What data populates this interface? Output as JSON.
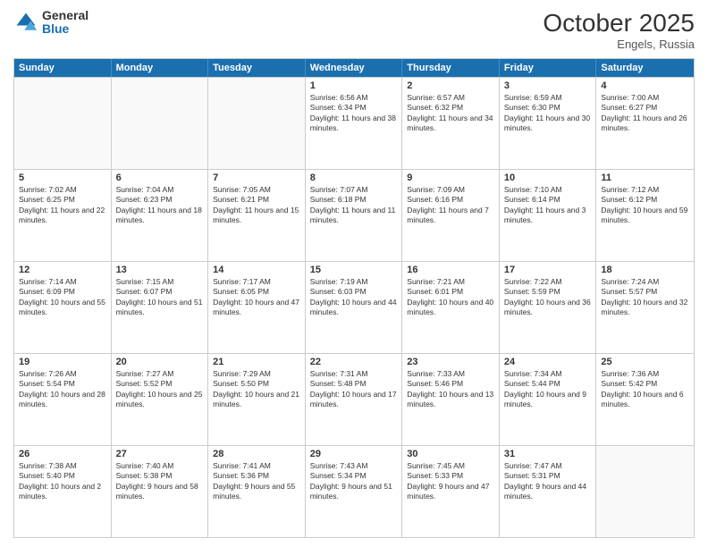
{
  "logo": {
    "general": "General",
    "blue": "Blue"
  },
  "header": {
    "month": "October 2025",
    "location": "Engels, Russia"
  },
  "days_of_week": [
    "Sunday",
    "Monday",
    "Tuesday",
    "Wednesday",
    "Thursday",
    "Friday",
    "Saturday"
  ],
  "weeks": [
    [
      {
        "day": "",
        "text": ""
      },
      {
        "day": "",
        "text": ""
      },
      {
        "day": "",
        "text": ""
      },
      {
        "day": "1",
        "text": "Sunrise: 6:56 AM\nSunset: 6:34 PM\nDaylight: 11 hours and 38 minutes."
      },
      {
        "day": "2",
        "text": "Sunrise: 6:57 AM\nSunset: 6:32 PM\nDaylight: 11 hours and 34 minutes."
      },
      {
        "day": "3",
        "text": "Sunrise: 6:59 AM\nSunset: 6:30 PM\nDaylight: 11 hours and 30 minutes."
      },
      {
        "day": "4",
        "text": "Sunrise: 7:00 AM\nSunset: 6:27 PM\nDaylight: 11 hours and 26 minutes."
      }
    ],
    [
      {
        "day": "5",
        "text": "Sunrise: 7:02 AM\nSunset: 6:25 PM\nDaylight: 11 hours and 22 minutes."
      },
      {
        "day": "6",
        "text": "Sunrise: 7:04 AM\nSunset: 6:23 PM\nDaylight: 11 hours and 18 minutes."
      },
      {
        "day": "7",
        "text": "Sunrise: 7:05 AM\nSunset: 6:21 PM\nDaylight: 11 hours and 15 minutes."
      },
      {
        "day": "8",
        "text": "Sunrise: 7:07 AM\nSunset: 6:18 PM\nDaylight: 11 hours and 11 minutes."
      },
      {
        "day": "9",
        "text": "Sunrise: 7:09 AM\nSunset: 6:16 PM\nDaylight: 11 hours and 7 minutes."
      },
      {
        "day": "10",
        "text": "Sunrise: 7:10 AM\nSunset: 6:14 PM\nDaylight: 11 hours and 3 minutes."
      },
      {
        "day": "11",
        "text": "Sunrise: 7:12 AM\nSunset: 6:12 PM\nDaylight: 10 hours and 59 minutes."
      }
    ],
    [
      {
        "day": "12",
        "text": "Sunrise: 7:14 AM\nSunset: 6:09 PM\nDaylight: 10 hours and 55 minutes."
      },
      {
        "day": "13",
        "text": "Sunrise: 7:15 AM\nSunset: 6:07 PM\nDaylight: 10 hours and 51 minutes."
      },
      {
        "day": "14",
        "text": "Sunrise: 7:17 AM\nSunset: 6:05 PM\nDaylight: 10 hours and 47 minutes."
      },
      {
        "day": "15",
        "text": "Sunrise: 7:19 AM\nSunset: 6:03 PM\nDaylight: 10 hours and 44 minutes."
      },
      {
        "day": "16",
        "text": "Sunrise: 7:21 AM\nSunset: 6:01 PM\nDaylight: 10 hours and 40 minutes."
      },
      {
        "day": "17",
        "text": "Sunrise: 7:22 AM\nSunset: 5:59 PM\nDaylight: 10 hours and 36 minutes."
      },
      {
        "day": "18",
        "text": "Sunrise: 7:24 AM\nSunset: 5:57 PM\nDaylight: 10 hours and 32 minutes."
      }
    ],
    [
      {
        "day": "19",
        "text": "Sunrise: 7:26 AM\nSunset: 5:54 PM\nDaylight: 10 hours and 28 minutes."
      },
      {
        "day": "20",
        "text": "Sunrise: 7:27 AM\nSunset: 5:52 PM\nDaylight: 10 hours and 25 minutes."
      },
      {
        "day": "21",
        "text": "Sunrise: 7:29 AM\nSunset: 5:50 PM\nDaylight: 10 hours and 21 minutes."
      },
      {
        "day": "22",
        "text": "Sunrise: 7:31 AM\nSunset: 5:48 PM\nDaylight: 10 hours and 17 minutes."
      },
      {
        "day": "23",
        "text": "Sunrise: 7:33 AM\nSunset: 5:46 PM\nDaylight: 10 hours and 13 minutes."
      },
      {
        "day": "24",
        "text": "Sunrise: 7:34 AM\nSunset: 5:44 PM\nDaylight: 10 hours and 9 minutes."
      },
      {
        "day": "25",
        "text": "Sunrise: 7:36 AM\nSunset: 5:42 PM\nDaylight: 10 hours and 6 minutes."
      }
    ],
    [
      {
        "day": "26",
        "text": "Sunrise: 7:38 AM\nSunset: 5:40 PM\nDaylight: 10 hours and 2 minutes."
      },
      {
        "day": "27",
        "text": "Sunrise: 7:40 AM\nSunset: 5:38 PM\nDaylight: 9 hours and 58 minutes."
      },
      {
        "day": "28",
        "text": "Sunrise: 7:41 AM\nSunset: 5:36 PM\nDaylight: 9 hours and 55 minutes."
      },
      {
        "day": "29",
        "text": "Sunrise: 7:43 AM\nSunset: 5:34 PM\nDaylight: 9 hours and 51 minutes."
      },
      {
        "day": "30",
        "text": "Sunrise: 7:45 AM\nSunset: 5:33 PM\nDaylight: 9 hours and 47 minutes."
      },
      {
        "day": "31",
        "text": "Sunrise: 7:47 AM\nSunset: 5:31 PM\nDaylight: 9 hours and 44 minutes."
      },
      {
        "day": "",
        "text": ""
      }
    ]
  ]
}
